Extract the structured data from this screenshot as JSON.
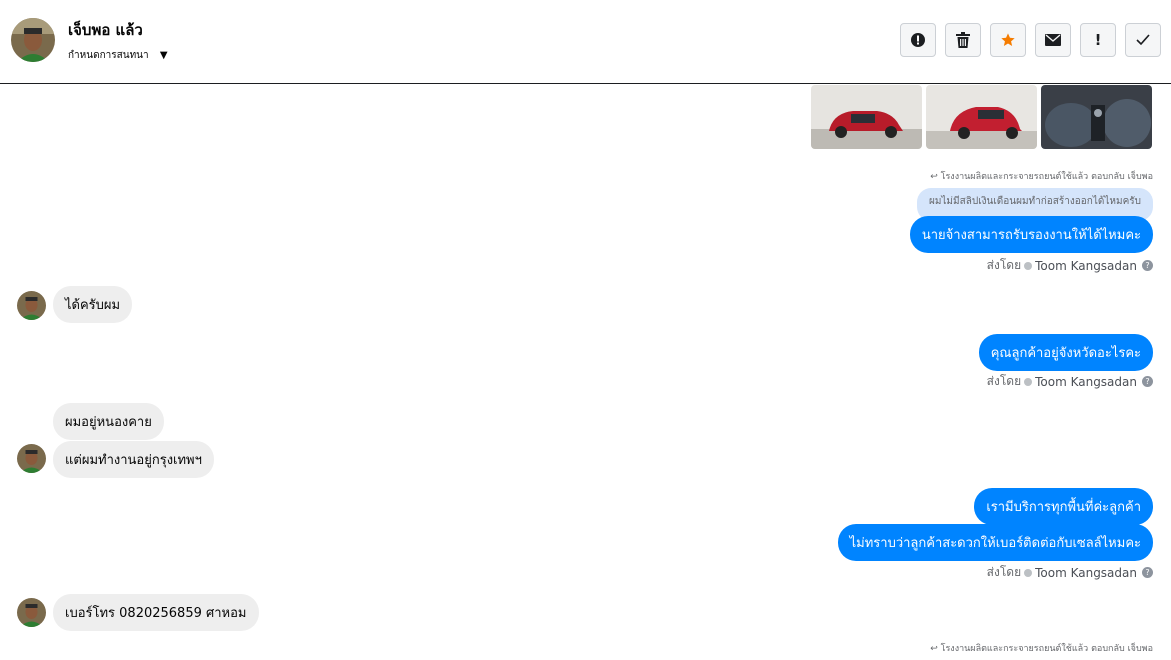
{
  "header": {
    "contact_name": "เจ็บพอ แล้ว",
    "manage_label": "กำหนดการสนทนา",
    "toolbar": [
      {
        "name": "spam-alert-icon",
        "label": "!"
      },
      {
        "name": "trash-icon",
        "label": ""
      },
      {
        "name": "star-icon",
        "label": ""
      },
      {
        "name": "envelope-icon",
        "label": ""
      },
      {
        "name": "exclamation-icon",
        "label": "!"
      },
      {
        "name": "checkmark-icon",
        "label": ""
      }
    ]
  },
  "colors": {
    "outgoing_bubble": "#0084ff",
    "incoming_bubble": "#eeeeee",
    "quoted_bubble": "#d5e5fb",
    "star": "#f57c00"
  },
  "messages": {
    "reply_note_1": "โรงงานผลิตและกระจายรถยนต์ใช้แล้ว ตอบกลับ เจ็บพอ",
    "quoted_text": "ผมไม่มีสลิปเงินเดือนผมทำก่อสร้างออกได้ไหมครับ",
    "out_1": "นายจ้างสามารถรับรองงานให้ได้ไหมคะ",
    "in_1": "ได้ครับผม",
    "out_2": "คุณลูกค้าอยู่จังหวัดอะไรคะ",
    "in_2": "ผมอยู่หนองคาย",
    "in_3": "แต่ผมทำงานอยู่กรุงเทพฯ",
    "out_3": "เรามีบริการทุกพื้นที่ค่ะลูกค้า",
    "out_4": "ไม่ทราบว่าลูกค้าสะดวกให้เบอร์ติดต่อกับเซลล์ไหมคะ",
    "in_4": "เบอร์โทร 0820256859 ศาหอม",
    "reply_note_2": "โรงงานผลิตและกระจายรถยนต์ใช้แล้ว ตอบกลับ เจ็บพอ"
  },
  "sent_by": {
    "prefix": "ส่งโดย",
    "agent": "Toom Kangsadan"
  }
}
